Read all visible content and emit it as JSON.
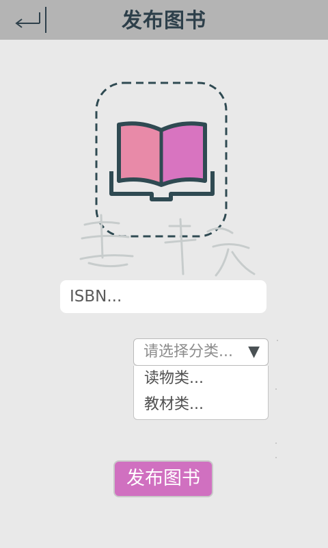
{
  "header": {
    "title": "发布图书",
    "back_icon": "return-arrow-icon"
  },
  "cover": {
    "icon": "open-book-icon",
    "page_colors": [
      "#e88aa8",
      "#d874c0"
    ],
    "outline_color": "#2f4a52"
  },
  "isbn": {
    "placeholder": "ISBN..."
  },
  "category": {
    "placeholder": "请选择分类...",
    "arrow": "▼",
    "options": [
      "读物类...",
      "教材类..."
    ]
  },
  "submit": {
    "label": "发布图书",
    "color": "#d070c0"
  }
}
